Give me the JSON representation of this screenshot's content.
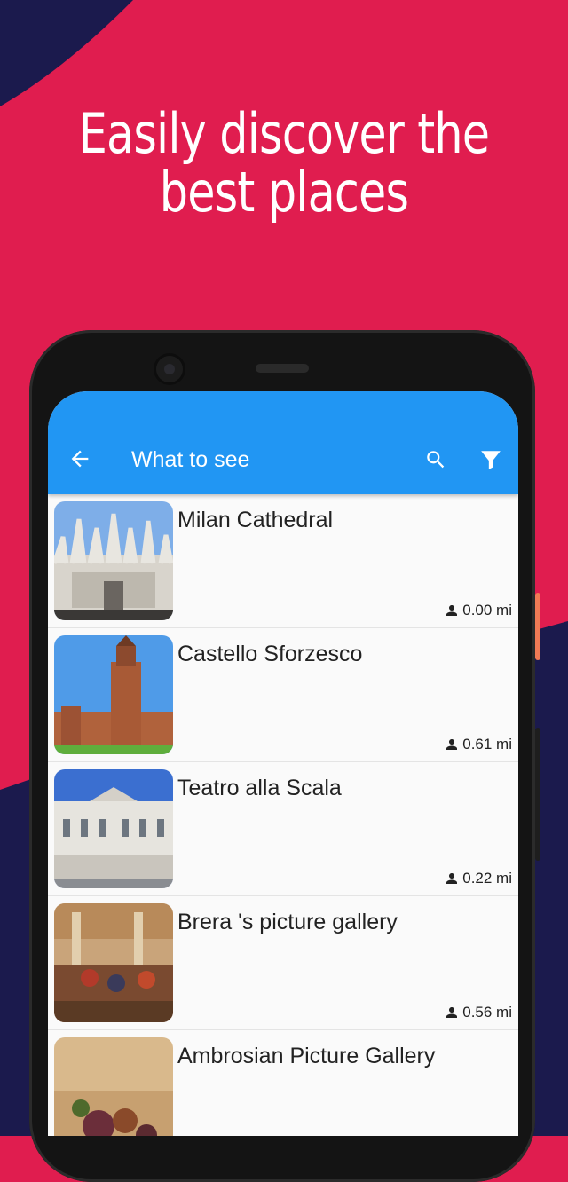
{
  "headline": {
    "line1": "Easily discover the",
    "line2": "best places"
  },
  "colors": {
    "background": "#e01d4f",
    "navy": "#1b1a4d",
    "appbar": "#2196f3"
  },
  "appbar": {
    "back_icon": "arrow-back-icon",
    "title": "What to see",
    "search_icon": "search-icon",
    "filter_icon": "filter-icon"
  },
  "places": [
    {
      "name": "Milan Cathedral",
      "distance": "0.00 mi"
    },
    {
      "name": "Castello Sforzesco",
      "distance": "0.61 mi"
    },
    {
      "name": "Teatro alla Scala",
      "distance": "0.22 mi"
    },
    {
      "name": "Brera 's picture gallery",
      "distance": "0.56 mi"
    },
    {
      "name": "Ambrosian Picture Gallery",
      "distance": ""
    }
  ]
}
